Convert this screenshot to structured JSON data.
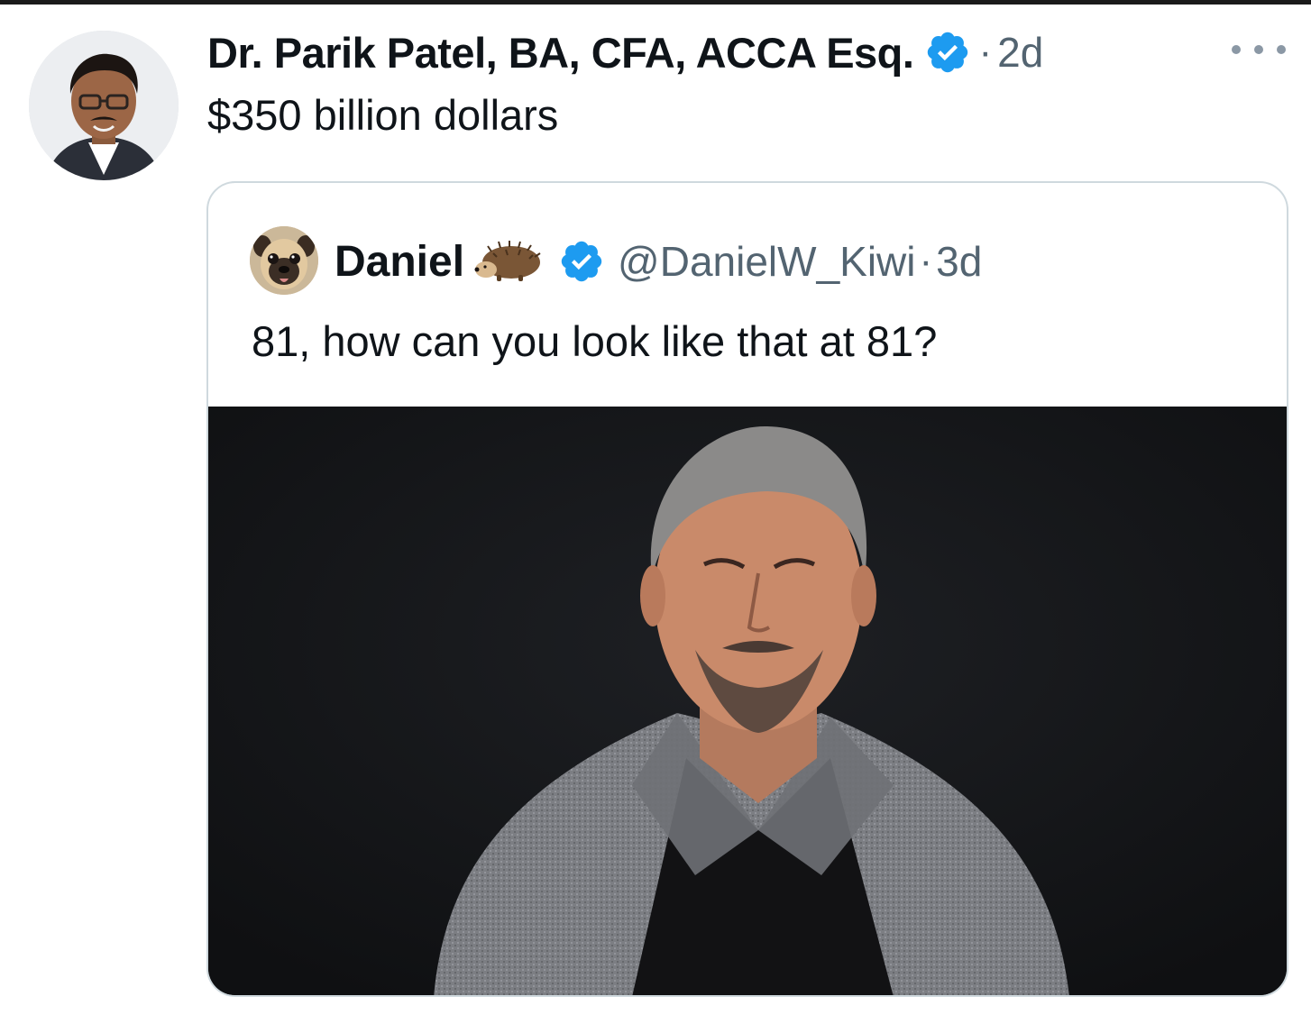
{
  "tweet": {
    "author_name": "Dr. Parik Patel, BA, CFA, ACCA Esq.",
    "separator": "·",
    "time": "2d",
    "text": "$350 billion dollars",
    "avatar_icon": "profile-photo-avatar",
    "verified_icon": "verified-badge-icon",
    "more_icon": "more-options-icon"
  },
  "quote": {
    "author_name": "Daniel",
    "name_emoji": "hedgehog-emoji",
    "handle": "@DanielW_Kiwi",
    "separator": "·",
    "time": "3d",
    "text": "81, how can you look like that at 81?",
    "avatar_icon": "pug-avatar",
    "verified_icon": "verified-badge-icon",
    "media": "photo-of-older-man-in-grey-blazer"
  },
  "colors": {
    "text": "#0f1419",
    "secondary": "#536471",
    "verified": "#1d9bf0",
    "border": "#cfd9de",
    "media_bg": "#141518"
  }
}
